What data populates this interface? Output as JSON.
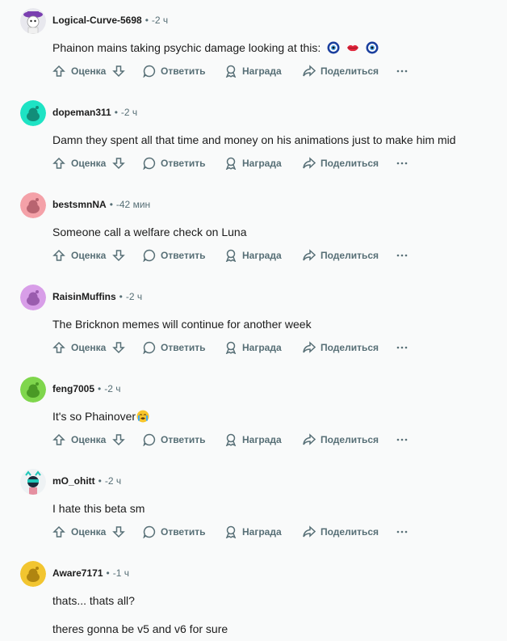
{
  "actions": {
    "vote_label": "Оценка",
    "reply_label": "Ответить",
    "award_label": "Награда",
    "share_label": "Поделиться"
  },
  "separator": "•",
  "comments": [
    {
      "username": "Logical-Curve-5698",
      "time": "-2 ч",
      "text": "Phainon mains taking psychic damage looking at this:",
      "avatar_color": "#ffffff",
      "emojis": [
        "nazar-amulet-icon",
        "lips-icon",
        "nazar-amulet-icon"
      ]
    },
    {
      "username": "dopeman311",
      "time": "-2 ч",
      "text": "Damn they spent all that time and money on his animations just to make him mid",
      "avatar_color": "#1ee3c4"
    },
    {
      "username": "bestsmnNA",
      "time": "-42 мин",
      "text": "Someone call a welfare check on Luna",
      "avatar_color": "#f4a1a8"
    },
    {
      "username": "RaisinMuffins",
      "time": "-2 ч",
      "text": "The Bricknon memes will continue for another week",
      "avatar_color": "#d89ee8"
    },
    {
      "username": "feng7005",
      "time": "-2 ч",
      "text": "It's so Phainover",
      "avatar_color": "#7fd64c",
      "emojis": [
        "crying-face-icon"
      ]
    },
    {
      "username": "mO_ohitt",
      "time": "-2 ч",
      "text": "I hate this beta sm",
      "avatar_color": "#ffffff"
    },
    {
      "username": "Aware7171",
      "time": "-1 ч",
      "text": "thats... thats all?",
      "text2": "theres gonna be v5 and v6 for sure",
      "avatar_color": "#f2c530"
    }
  ]
}
